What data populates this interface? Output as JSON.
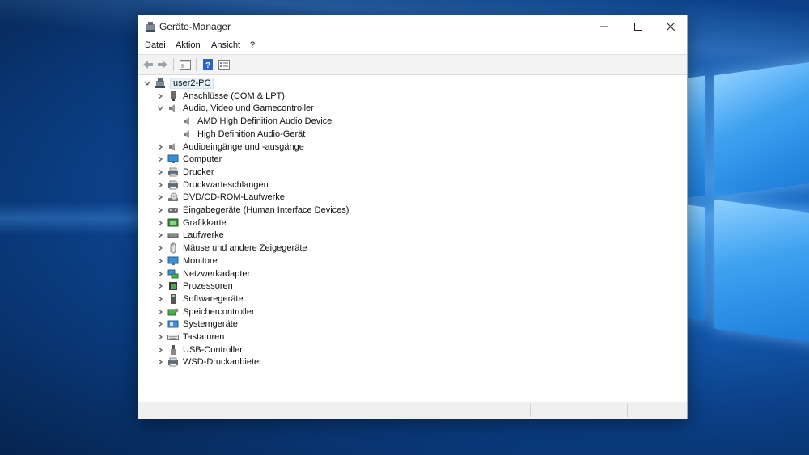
{
  "window": {
    "title": "Geräte-Manager",
    "caption_buttons": {
      "minimize": "–",
      "maximize": "☐",
      "close": "✕"
    }
  },
  "menu": [
    "Datei",
    "Aktion",
    "Ansicht",
    "?"
  ],
  "toolbar": {
    "buttons": [
      "back-arrow-icon",
      "forward-arrow-icon",
      "properties-icon",
      "help-icon",
      "view-icon"
    ]
  },
  "tree": {
    "root": {
      "label": "user2-PC",
      "expanded": true
    },
    "items": [
      {
        "label": "Anschlüsse (COM & LPT)",
        "icon": "port-icon",
        "expanded": false
      },
      {
        "label": "Audio, Video und Gamecontroller",
        "icon": "speaker-icon",
        "expanded": true,
        "children": [
          {
            "label": "AMD High Definition Audio Device",
            "icon": "speaker-icon"
          },
          {
            "label": "High Definition Audio-Gerät",
            "icon": "speaker-icon"
          }
        ]
      },
      {
        "label": "Audioeingänge und -ausgänge",
        "icon": "speaker-icon",
        "expanded": false
      },
      {
        "label": "Computer",
        "icon": "monitor-icon",
        "expanded": false
      },
      {
        "label": "Drucker",
        "icon": "printer-icon",
        "expanded": false
      },
      {
        "label": "Druckwarteschlangen",
        "icon": "printer-icon",
        "expanded": false
      },
      {
        "label": "DVD/CD-ROM-Laufwerke",
        "icon": "disc-drive-icon",
        "expanded": false
      },
      {
        "label": "Eingabegeräte (Human Interface Devices)",
        "icon": "hid-icon",
        "expanded": false
      },
      {
        "label": "Grafikkarte",
        "icon": "display-adapter-icon",
        "expanded": false
      },
      {
        "label": "Laufwerke",
        "icon": "disk-drive-icon",
        "expanded": false
      },
      {
        "label": "Mäuse und andere Zeigegeräte",
        "icon": "mouse-icon",
        "expanded": false
      },
      {
        "label": "Monitore",
        "icon": "monitor-icon",
        "expanded": false
      },
      {
        "label": "Netzwerkadapter",
        "icon": "network-adapter-icon",
        "expanded": false
      },
      {
        "label": "Prozessoren",
        "icon": "processor-icon",
        "expanded": false
      },
      {
        "label": "Softwaregeräte",
        "icon": "software-device-icon",
        "expanded": false
      },
      {
        "label": "Speichercontroller",
        "icon": "storage-controller-icon",
        "expanded": false
      },
      {
        "label": "Systemgeräte",
        "icon": "system-device-icon",
        "expanded": false
      },
      {
        "label": "Tastaturen",
        "icon": "keyboard-icon",
        "expanded": false
      },
      {
        "label": "USB-Controller",
        "icon": "usb-icon",
        "expanded": false
      },
      {
        "label": "WSD-Druckanbieter",
        "icon": "printer-icon",
        "expanded": false
      }
    ]
  }
}
